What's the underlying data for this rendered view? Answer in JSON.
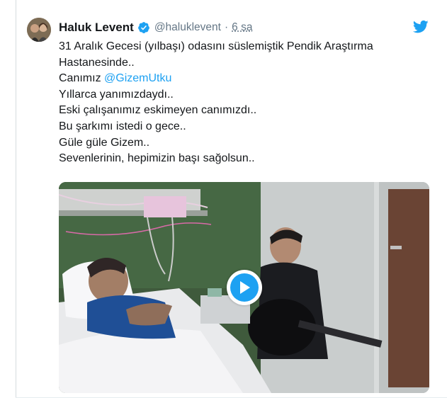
{
  "tweet": {
    "author_name": "Haluk Levent",
    "handle": "@haluklevent",
    "separator": "·",
    "time": "6 sa",
    "verified": true,
    "lines": {
      "l1": "31 Aralık Gecesi (yılbaşı) odasını süslemiştik Pendik Araştırma",
      "l2": "Hastanesinde..",
      "l3_prefix": "Canımız ",
      "l3_mention": "@GizemUtku",
      "l4": "Yıllarca yanımızdaydı..",
      "l5": "Eski çalışanımız eskimeyen canımızdı..",
      "l6": "Bu şarkımı istedi o gece..",
      "l7": "Güle güle Gizem..",
      "l8": "Sevenlerinin, hepimizin başı sağolsun.."
    },
    "media": {
      "type": "video",
      "state": "paused"
    }
  },
  "icons": {
    "verified": "verified-badge-icon",
    "twitter": "twitter-bird-icon",
    "play": "play-icon"
  },
  "colors": {
    "brand": "#1da1f2",
    "text": "#14171a",
    "muted": "#657786"
  }
}
